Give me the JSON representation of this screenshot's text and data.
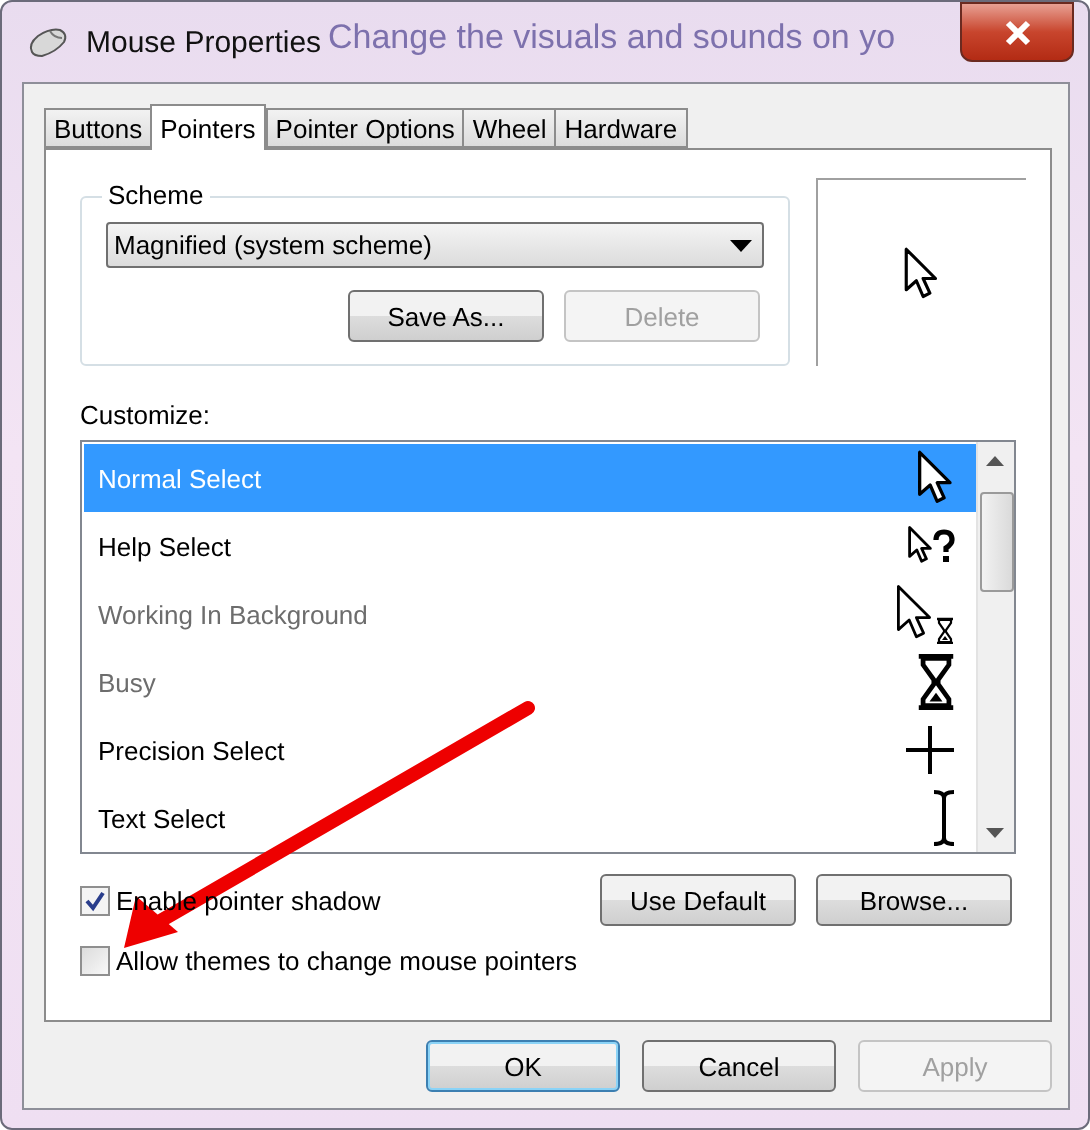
{
  "background_text": "Change the visuals and sounds on yo",
  "window": {
    "title": "Mouse Properties"
  },
  "tabs": [
    {
      "label": "Buttons",
      "selected": false
    },
    {
      "label": "Pointers",
      "selected": true
    },
    {
      "label": "Pointer Options",
      "selected": false
    },
    {
      "label": "Wheel",
      "selected": false
    },
    {
      "label": "Hardware",
      "selected": false
    }
  ],
  "scheme": {
    "label": "Scheme",
    "value": "Magnified (system scheme)",
    "buttons": [
      {
        "label": "Save As...",
        "disabled": false
      },
      {
        "label": "Delete",
        "disabled": true
      }
    ]
  },
  "customize": {
    "label": "Customize:",
    "items": [
      {
        "name": "Normal Select",
        "kind": "arrow",
        "selected": true,
        "disabled": false
      },
      {
        "name": "Help Select",
        "kind": "help",
        "selected": false,
        "disabled": false
      },
      {
        "name": "Working In Background",
        "kind": "working",
        "selected": false,
        "disabled": true
      },
      {
        "name": "Busy",
        "kind": "busy",
        "selected": false,
        "disabled": true
      },
      {
        "name": "Precision Select",
        "kind": "cross",
        "selected": false,
        "disabled": false
      },
      {
        "name": "Text Select",
        "kind": "ibeam",
        "selected": false,
        "disabled": false
      }
    ]
  },
  "checkboxes": [
    {
      "label": "Enable pointer shadow",
      "checked": true
    },
    {
      "label": "Allow themes to change mouse pointers",
      "checked": false
    }
  ],
  "list_buttons": [
    {
      "label": "Use Default",
      "disabled": false
    },
    {
      "label": "Browse...",
      "disabled": false
    }
  ],
  "footer_buttons": [
    {
      "label": "OK",
      "default": true,
      "disabled": false
    },
    {
      "label": "Cancel",
      "default": false,
      "disabled": false
    },
    {
      "label": "Apply",
      "default": false,
      "disabled": true
    }
  ]
}
